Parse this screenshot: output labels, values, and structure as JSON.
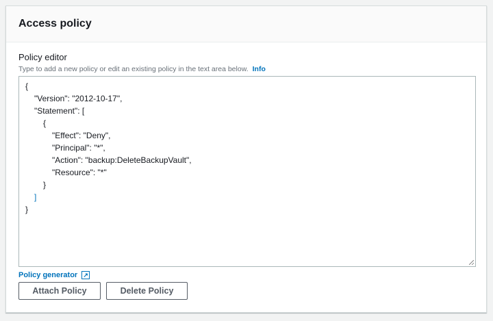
{
  "panel": {
    "title": "Access policy"
  },
  "editor": {
    "label": "Policy editor",
    "description": "Type to add a new policy or edit an existing policy in the text area below.",
    "info_link": "Info",
    "lines": [
      {
        "indent": 0,
        "text": "{"
      },
      {
        "indent": 1,
        "text": "\"Version\": \"2012-10-17\","
      },
      {
        "indent": 1,
        "text": "\"Statement\": ["
      },
      {
        "indent": 2,
        "text": "{"
      },
      {
        "indent": 3,
        "text": "\"Effect\": \"Deny\","
      },
      {
        "indent": 3,
        "text": "\"Principal\": \"*\","
      },
      {
        "indent": 3,
        "text": "\"Action\": \"backup:DeleteBackupVault\","
      },
      {
        "indent": 3,
        "text": "\"Resource\": \"*\""
      },
      {
        "indent": 2,
        "text": "}"
      },
      {
        "indent": 1,
        "text": "]"
      },
      {
        "indent": 0,
        "text": "}"
      }
    ]
  },
  "links": {
    "policy_generator": "Policy generator"
  },
  "buttons": {
    "attach": "Attach Policy",
    "delete": "Delete Policy"
  },
  "colors": {
    "link": "#0073bb"
  }
}
